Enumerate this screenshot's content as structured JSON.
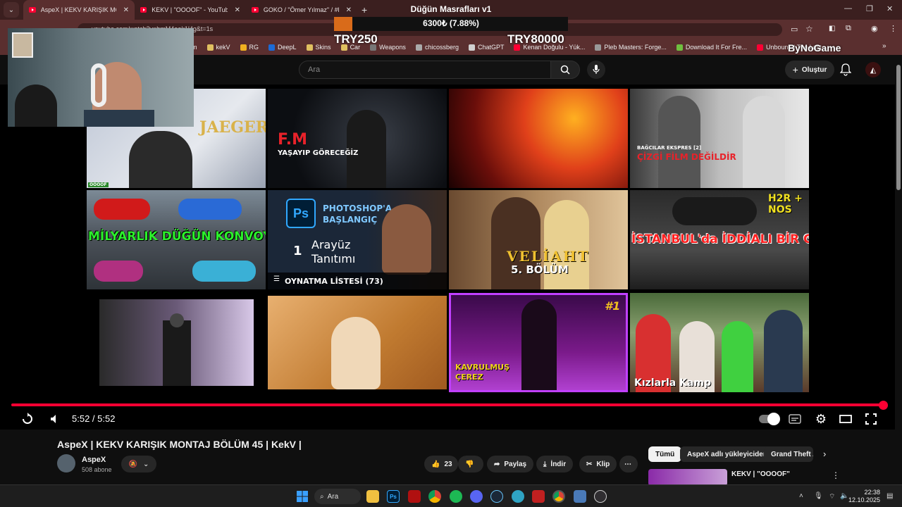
{
  "browser": {
    "tabs": [
      {
        "label": "AspeX | KEKV KARIŞIK MONTAJ BÖLÜ",
        "active": true
      },
      {
        "label": "KEKV | \"OOOOF\" - YouTube",
        "active": false
      },
      {
        "label": "GOKO / \"Ömer Yılmaz\" / #kekv",
        "active": false
      }
    ],
    "url": "youtube.com/watch?v=bmM4ook1l4g&t=1s",
    "bookmarks": [
      "m",
      "kekV",
      "RG",
      "DeepL",
      "Skins",
      "Car",
      "Weapons",
      "chicossberg",
      "ChatGPT",
      "Kenan Doğulu - Yük...",
      "Pleb Masters: Forge...",
      "Download It For Fre...",
      "Unbound | The Last..."
    ]
  },
  "overlay": {
    "title": "Düğün Masrafları v1",
    "progress_text": "6300₺ (7.88%)",
    "progress_fraction": 0.0788,
    "min_label": "TRY250",
    "max_label": "TRY80000",
    "sponsor": "ByNoGame"
  },
  "youtube": {
    "search_placeholder": "Ara",
    "create_label": "Oluştur",
    "thumbnails": [
      {
        "caption": "JAEGER",
        "badge": "OOOOF"
      },
      {
        "caption": "F.M",
        "subcaption": "YAŞAYIP GÖRECEĞİZ"
      },
      {
        "caption": ""
      },
      {
        "caption": "BAĞCILAR EKSPRES [2]",
        "subcaption": "ÇİZGİ FİLM DEĞİLDİR"
      },
      {
        "caption": "MİLYARLIK DÜĞÜN KONVOYU!"
      },
      {
        "caption": "PHOTOSHOP'A BAŞLANGIÇ",
        "subcaption": "Arayüz Tanıtımı",
        "number": "1",
        "playlist": "OYNATMA LİSTESİ (73)"
      },
      {
        "caption": "VELİAHT",
        "subcaption": "5. BÖLÜM"
      },
      {
        "caption": "İSTANBUL'da İDDİALI BİR GECE!",
        "badge": "H2R + NOS"
      },
      {
        "caption": ""
      },
      {
        "caption": ""
      },
      {
        "caption": "KAVRULMUŞ ÇEREZ",
        "badge": "#1"
      },
      {
        "caption": "Kızlarla Kamp"
      }
    ],
    "player": {
      "time": "5:52 / 5:52",
      "progress_fraction": 1.0
    },
    "video": {
      "title": "AspeX | KEKV KARIŞIK MONTAJ BÖLÜM 45 | KekV |",
      "channel": "AspeX",
      "subscribers": "508 abone",
      "likes": "23",
      "share_label": "Paylaş",
      "download_label": "İndir",
      "clip_label": "Klip"
    },
    "chips": [
      "Tümü",
      "AspeX adlı yükleyiciden",
      "Grand Theft A"
    ],
    "recommended": {
      "title": "KEKV | \"OOOOF\""
    }
  },
  "taskbar": {
    "search_label": "Ara",
    "time": "22:38",
    "date": "12.10.2025"
  },
  "colors": {
    "accent": "#ff0033",
    "chrome": "#5a2f2f",
    "overlay_fill": "#d96b1a"
  }
}
